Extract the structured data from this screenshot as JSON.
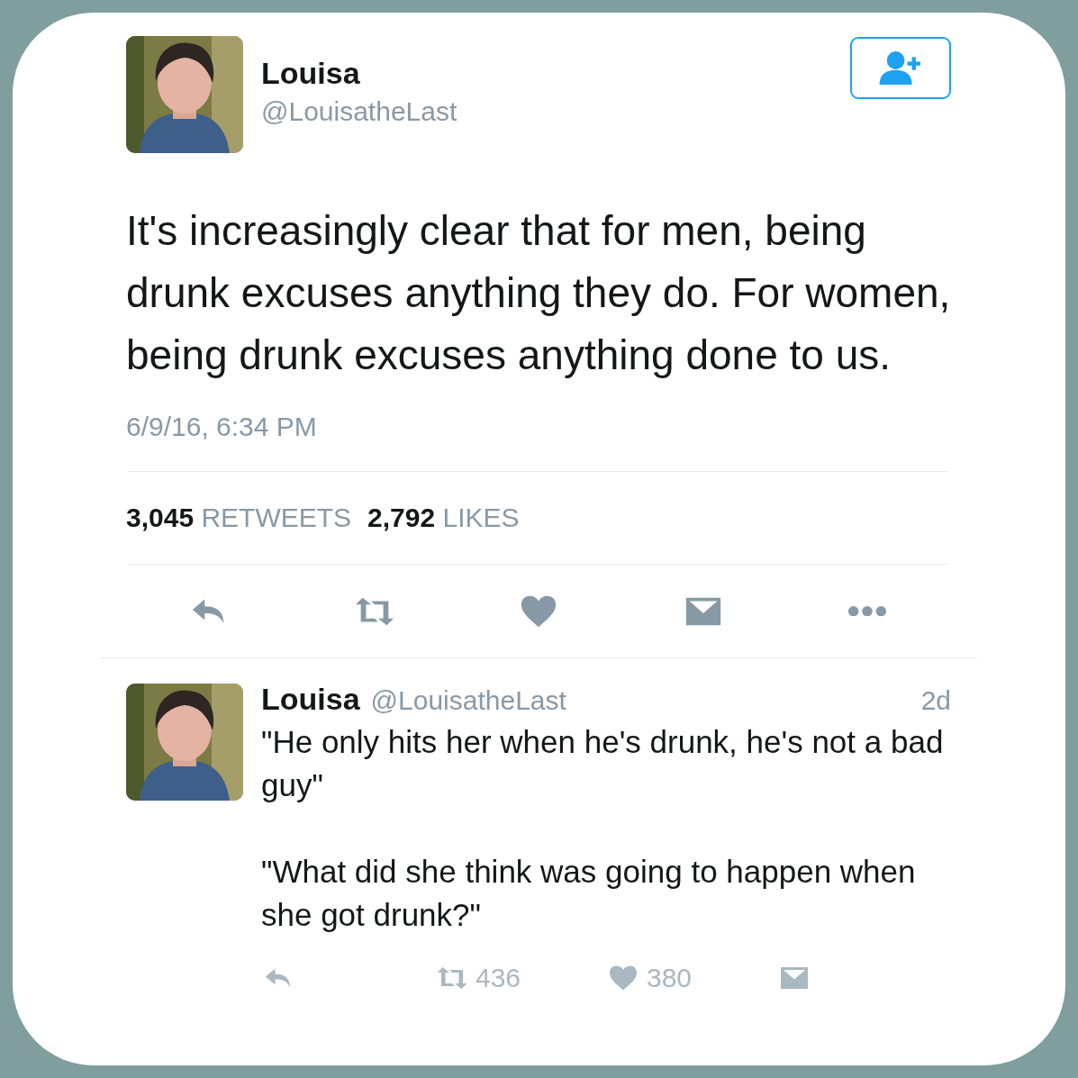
{
  "tweet": {
    "author": {
      "name": "Louisa",
      "handle": "@LouisatheLast"
    },
    "text": "It's increasingly clear that for men, being drunk excuses anything they do. For women, being drunk excuses anything done to us.",
    "timestamp": "6/9/16, 6:34 PM",
    "stats": [
      {
        "count": "3,045",
        "label": "RETWEETS"
      },
      {
        "count": "2,792",
        "label": "LIKES"
      }
    ],
    "actions": [
      {
        "kind": "reply"
      },
      {
        "kind": "retweet"
      },
      {
        "kind": "like"
      },
      {
        "kind": "message"
      },
      {
        "kind": "more"
      }
    ]
  },
  "reply": {
    "author": {
      "name": "Louisa",
      "handle": "@LouisatheLast"
    },
    "time": "2d",
    "paragraphs": [
      "\"He only hits her when he's drunk, he's not a bad guy\"",
      "\"What did she think was going to happen when she got drunk?\""
    ],
    "actions": [
      {
        "kind": "reply"
      },
      {
        "kind": "retweet",
        "count": "436"
      },
      {
        "kind": "like",
        "count": "380"
      },
      {
        "kind": "message"
      }
    ]
  }
}
